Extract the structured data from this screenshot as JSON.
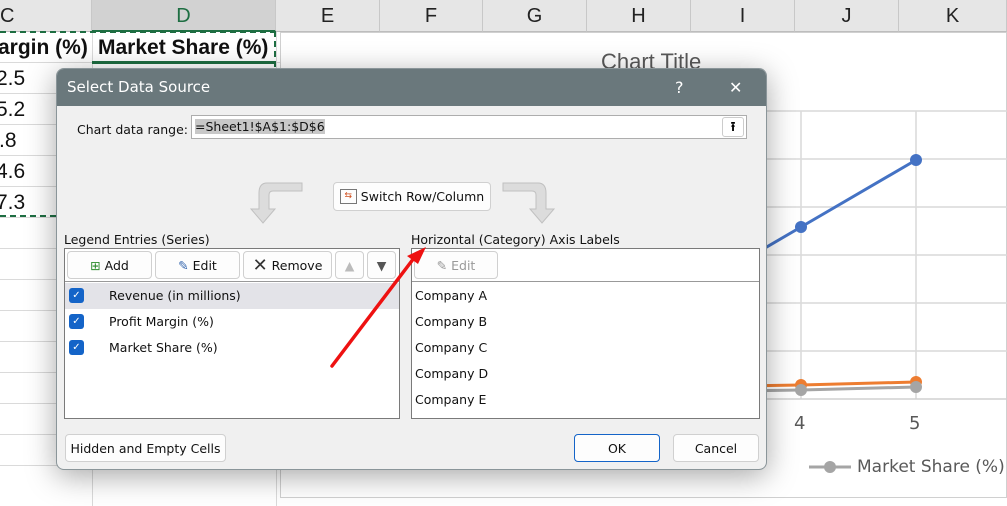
{
  "sheet": {
    "columns": [
      "C",
      "D",
      "E",
      "F",
      "G",
      "H",
      "I",
      "J",
      "K"
    ],
    "header_cells": {
      "C": "argin (%)",
      "D": "Market Share (%)"
    },
    "column_c_values": [
      "2.5",
      "5.2",
      ".8",
      "4.6",
      "7.3"
    ]
  },
  "chart_data": {
    "type": "line",
    "title": "Chart Title",
    "x_tick_labels": [
      "4",
      "5"
    ],
    "legend": [
      "Market Share (%)"
    ],
    "legend_placement": "bottom",
    "grid": true,
    "colors": {
      "revenue": "#4472c4",
      "profit_margin": "#ed7d31",
      "market_share": "#a5a5a5"
    }
  },
  "dialog": {
    "title": "Select Data Source",
    "help": "?",
    "close": "✕",
    "range_label": "Chart data range:",
    "range_value": "=Sheet1!$A$1:$D$6",
    "switch_label": "Switch Row/Column",
    "legend_title": "Legend Entries (Series)",
    "add": "Add",
    "edit": "Edit",
    "remove": "Remove",
    "series": [
      {
        "label": "Revenue (in millions)",
        "checked": true
      },
      {
        "label": "Profit Margin (%)",
        "checked": true
      },
      {
        "label": "Market Share (%)",
        "checked": true
      }
    ],
    "axis_title": "Horizontal (Category) Axis Labels",
    "axis_edit": "Edit",
    "categories": [
      "Company A",
      "Company B",
      "Company C",
      "Company D",
      "Company E"
    ],
    "hidden_cells": "Hidden and Empty Cells",
    "ok": "OK",
    "cancel": "Cancel"
  }
}
